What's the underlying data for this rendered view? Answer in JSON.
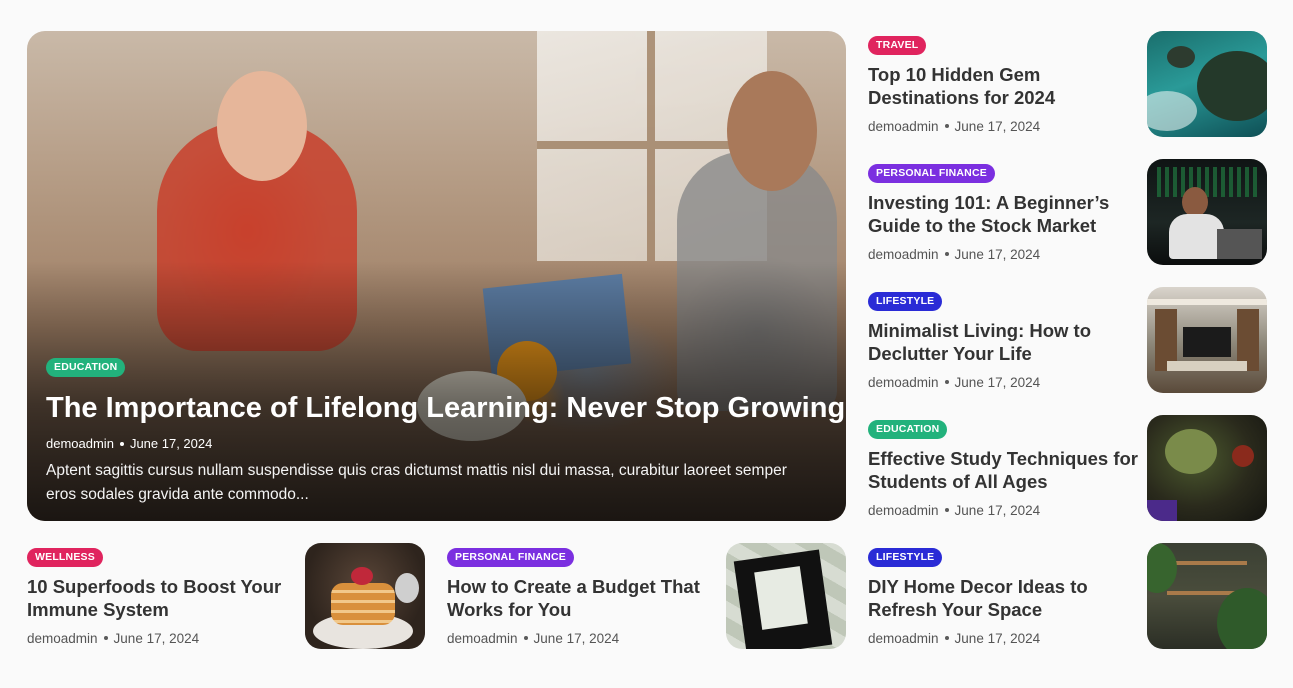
{
  "hero": {
    "category": "EDUCATION",
    "category_color": "#22b27c",
    "title": "The Importance of Lifelong Learning: Never Stop Growing",
    "author": "demoadmin",
    "date": "June 17, 2024",
    "excerpt": "Aptent sagittis cursus nullam suspendisse quis cras dictumst mattis nisl dui massa, curabitur laoreet semper eros sodales gravida ante commodo..."
  },
  "side_posts": [
    {
      "category": "TRAVEL",
      "category_color": "#e0245e",
      "title": "Top 10 Hidden Gem Destinations for 2024",
      "author": "demoadmin",
      "date": "June 17, 2024",
      "thumb_icon": "coastline-photo"
    },
    {
      "category": "PERSONAL FINANCE",
      "category_color": "#7b2fe0",
      "title": "Investing 101: A Beginner’s Guide to the Stock Market",
      "author": "demoadmin",
      "date": "June 17, 2024",
      "thumb_icon": "trader-photo"
    },
    {
      "category": "LIFESTYLE",
      "category_color": "#2a2bd6",
      "title": "Minimalist Living: How to Declutter Your Life",
      "author": "demoadmin",
      "date": "June 17, 2024",
      "thumb_icon": "living-room-photo"
    },
    {
      "category": "EDUCATION",
      "category_color": "#22b27c",
      "title": "Effective Study Techniques for Students of All Ages",
      "author": "demoadmin",
      "date": "June 17, 2024",
      "thumb_icon": "toy-figure-photo"
    },
    {
      "category": "LIFESTYLE",
      "category_color": "#2a2bd6",
      "title": "DIY Home Decor Ideas to Refresh Your Space",
      "author": "demoadmin",
      "date": "June 17, 2024",
      "thumb_icon": "plants-shelf-photo"
    }
  ],
  "bottom_posts": [
    {
      "category": "WELLNESS",
      "category_color": "#e0245e",
      "title": "10 Superfoods to Boost Your Immune System",
      "author": "demoadmin",
      "date": "June 17, 2024",
      "thumb_icon": "pancakes-photo"
    },
    {
      "category": "PERSONAL FINANCE",
      "category_color": "#7b2fe0",
      "title": "How to Create a Budget That Works for You",
      "author": "demoadmin",
      "date": "June 17, 2024",
      "thumb_icon": "money-envelope-photo"
    }
  ]
}
